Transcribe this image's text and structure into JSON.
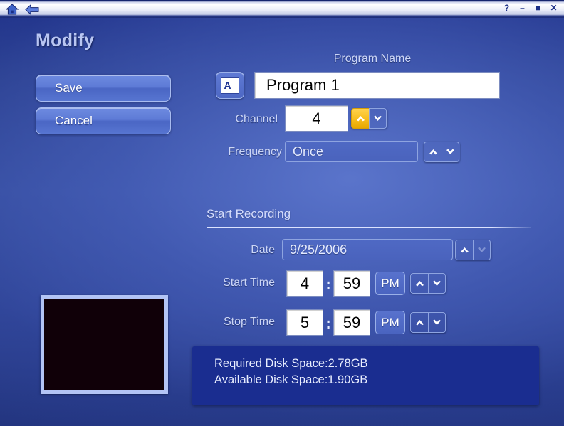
{
  "titlebar": {
    "nav": [
      {
        "name": "home-icon",
        "label": "Home"
      },
      {
        "name": "back-icon",
        "label": "Back"
      }
    ],
    "window_buttons": [
      {
        "name": "help-button",
        "glyph": "?"
      },
      {
        "name": "minimize-button",
        "glyph": "–"
      },
      {
        "name": "maximize-button",
        "glyph": "■"
      },
      {
        "name": "close-button",
        "glyph": "✕"
      }
    ]
  },
  "page": {
    "title": "Modify"
  },
  "actions": {
    "save_label": "Save",
    "cancel_label": "Cancel"
  },
  "form": {
    "program_name": {
      "label": "Program Name",
      "value": "Program 1",
      "icon_glyph": "A_",
      "icon_name": "text-entry-icon"
    },
    "channel": {
      "label": "Channel",
      "value": "4",
      "spinner_up_state": "highlighted",
      "spinner_down_state": "normal"
    },
    "frequency": {
      "label": "Frequency",
      "value": "Once",
      "spinner_up_state": "normal",
      "spinner_down_state": "normal"
    }
  },
  "start_recording": {
    "heading": "Start Recording",
    "date": {
      "label": "Date",
      "value": "9/25/2006",
      "spinner_up_state": "normal",
      "spinner_down_state": "disabled"
    },
    "start_time": {
      "label": "Start Time",
      "hour": "4",
      "separator": ":",
      "minute": "59",
      "meridiem": "PM"
    },
    "stop_time": {
      "label": "Stop Time",
      "hour": "5",
      "separator": ":",
      "minute": "59",
      "meridiem": "PM"
    }
  },
  "preview": {
    "name": "video-preview",
    "state": "blank"
  },
  "disk_info": {
    "required_line": "Required Disk Space:2.78GB",
    "available_line": "Available Disk Space:1.90GB"
  },
  "colors": {
    "accent_blue": "#4a64c0",
    "highlight_yellow": "#f7bd1d",
    "panel_navy": "#1a2d90",
    "title_text": "#b9c6f2"
  }
}
